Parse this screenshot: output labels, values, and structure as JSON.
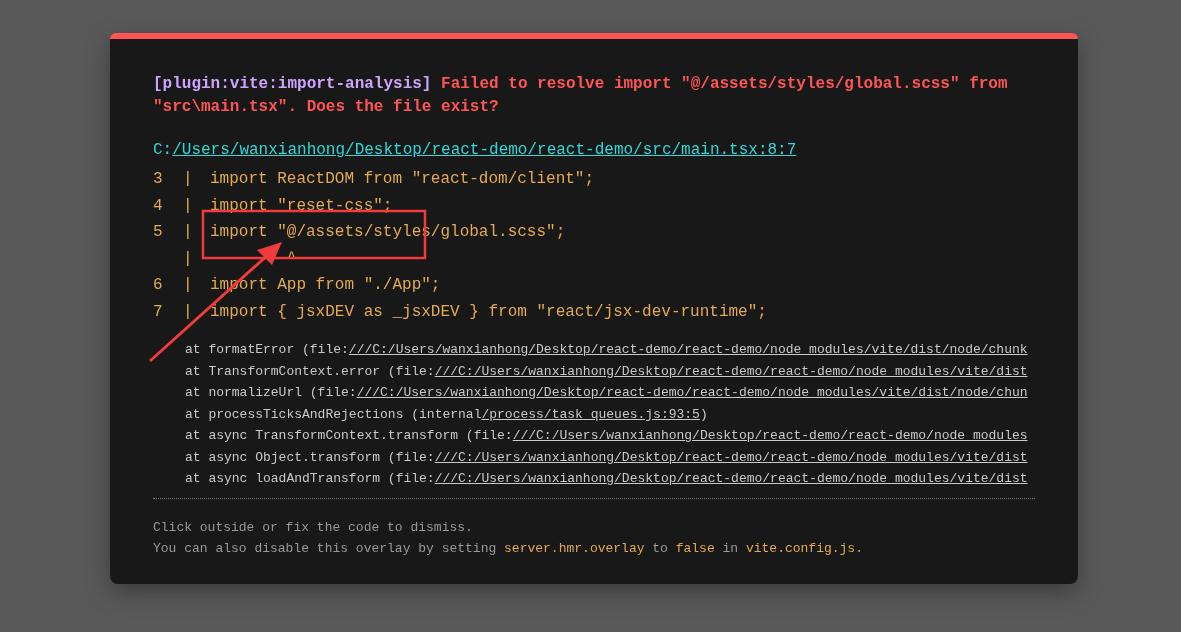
{
  "overlay": {
    "plugin": "[plugin:vite:import-analysis]",
    "message": "Failed to resolve import \"@/assets/styles/global.scss\" from \"src\\main.tsx\". Does the file exist?",
    "file": {
      "prefix": "C:",
      "link": "/Users/wanxianhong/Desktop/react-demo/react-demo/src/main.tsx:8:7"
    },
    "code_frame": [
      {
        "line_no": "3",
        "separator": "|",
        "code": "import ReactDOM from \"react-dom/client\";"
      },
      {
        "line_no": "4",
        "separator": "|",
        "code": "import \"reset-css\";"
      },
      {
        "line_no": "5",
        "separator": "|",
        "code": "import \"@/assets/styles/global.scss\";"
      },
      {
        "separator": "|",
        "code": "        ^"
      },
      {
        "line_no": "6",
        "separator": "|",
        "code": "import App from \"./App\";"
      },
      {
        "line_no": "7",
        "separator": "|",
        "code": "import { jsxDEV as _jsxDEV } from \"react/jsx-dev-runtime\";"
      }
    ],
    "stack": [
      {
        "text": "at formatError (file:",
        "link": "///C:/Users/wanxianhong/Desktop/react-demo/react-demo/node_modules/vite/dist/node/chunk"
      },
      {
        "text": "at TransformContext.error (file:",
        "link": "///C:/Users/wanxianhong/Desktop/react-demo/react-demo/node_modules/vite/dist"
      },
      {
        "text": "at normalizeUrl (file:",
        "link": "///C:/Users/wanxianhong/Desktop/react-demo/react-demo/node_modules/vite/dist/node/chun"
      },
      {
        "text": "at processTicksAndRejections (internal",
        "link": "/process/task_queues.js:93:5",
        "suffix": ")"
      },
      {
        "text": "at async TransformContext.transform (file:",
        "link": "///C:/Users/wanxianhong/Desktop/react-demo/react-demo/node_modules"
      },
      {
        "text": "at async Object.transform (file:",
        "link": "///C:/Users/wanxianhong/Desktop/react-demo/react-demo/node_modules/vite/dist"
      },
      {
        "text": "at async loadAndTransform (file:",
        "link": "///C:/Users/wanxianhong/Desktop/react-demo/react-demo/node_modules/vite/dist"
      }
    ],
    "tip": "Click outside or fix the code to dismiss.",
    "tip_2": [
      {
        "kind": "plain",
        "text": "You can also disable this overlay by setting"
      },
      {
        "kind": "code",
        "text": "server.hmr.overlay"
      },
      {
        "kind": "plain",
        "text": "to"
      },
      {
        "kind": "code",
        "text": "false"
      },
      {
        "kind": "plain",
        "text": "in"
      },
      {
        "kind": "code",
        "text": "vite.config.js."
      }
    ]
  }
}
